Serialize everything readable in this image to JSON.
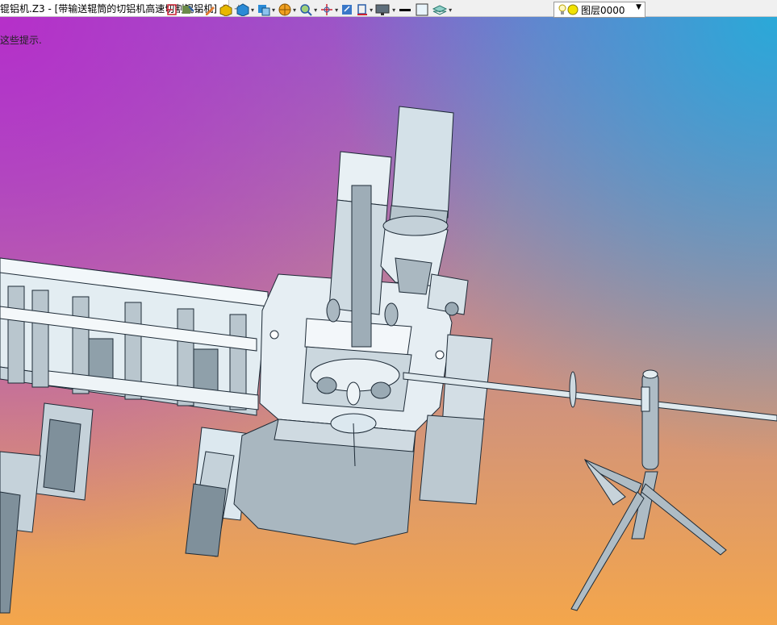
{
  "tab": {
    "title": "锟铝机.Z3 - [带输送辊筒的切铝机高速切割锟铝机]",
    "close_symbol": "✕",
    "add_symbol": "+"
  },
  "viewport": {
    "hint_text": "这些提示."
  },
  "toolbar": {
    "icons": [
      "exit-icon",
      "cursor-icon",
      "pencil-icon",
      "box-icon",
      "cube-icon",
      "view-cube-icon",
      "sphere-icon",
      "zoom-icon",
      "pan-icon",
      "frame-icon",
      "color-icon",
      "monitor-icon",
      "line-style-icon",
      "fill-color-icon",
      "layer-stack-icon"
    ],
    "layer": {
      "name": "图层0000"
    }
  },
  "colors": {
    "model_fill": "#dce8ef",
    "model_stroke": "#1d2a36",
    "dark_fill": "#a5b3bd"
  }
}
